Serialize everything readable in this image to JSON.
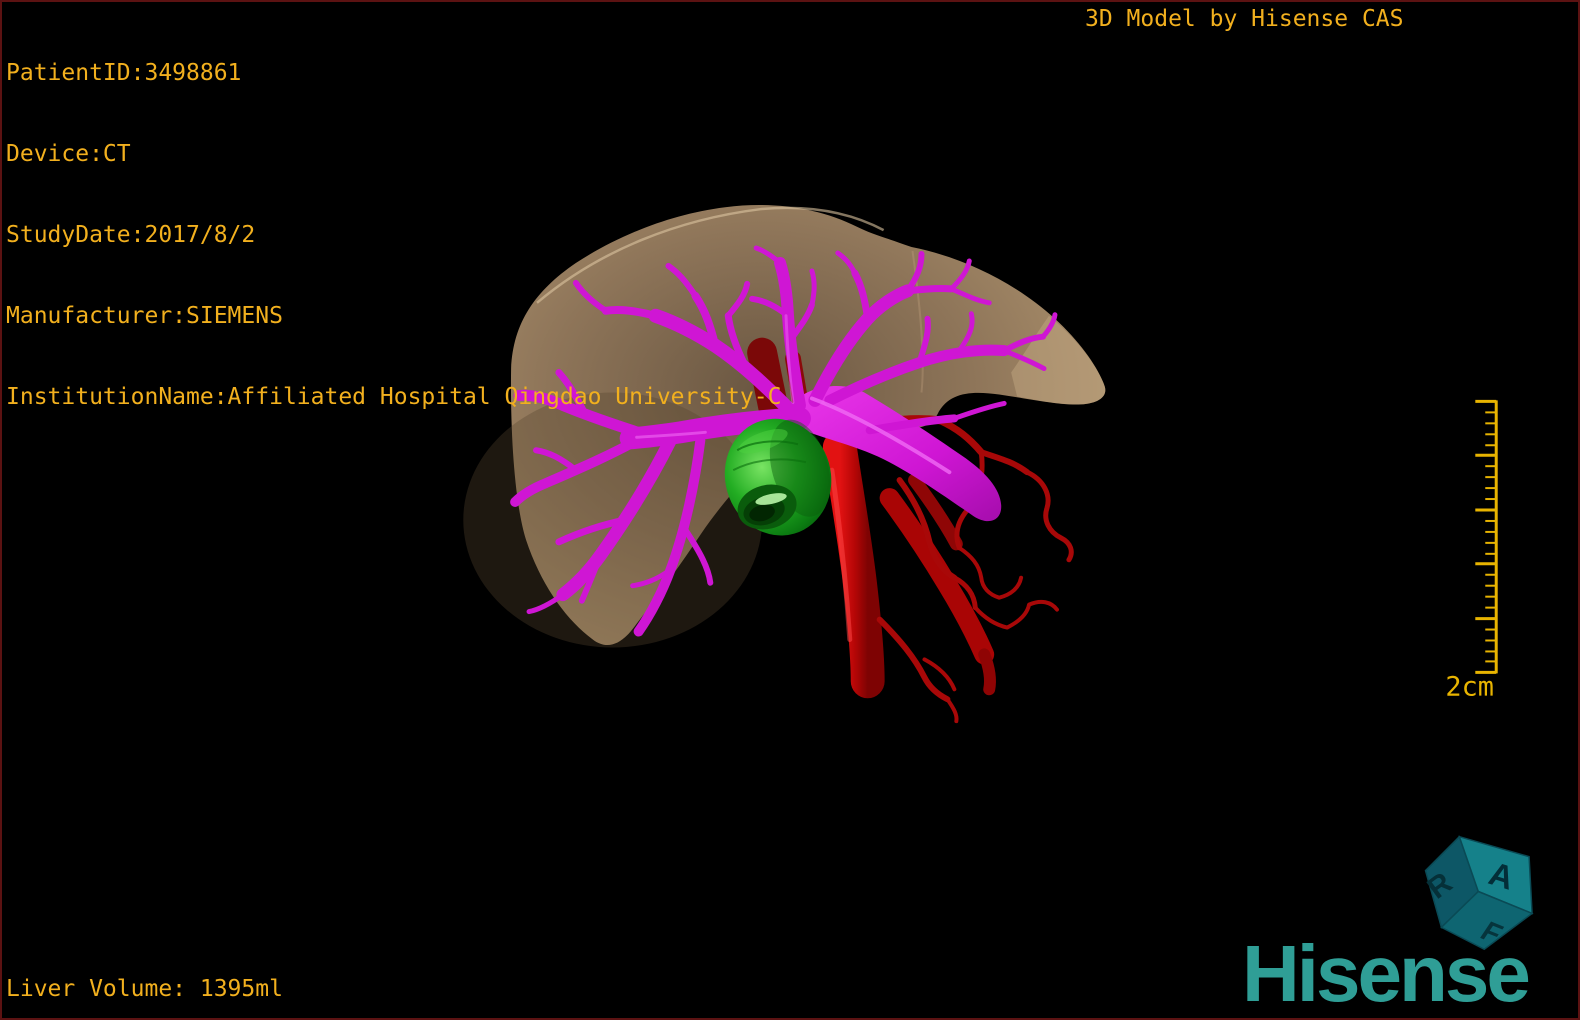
{
  "overlay": {
    "patient_info": [
      "PatientID:3498861",
      "Device:CT",
      "StudyDate:2017/8/2",
      "Manufacturer:SIEMENS",
      "InstitutionName:Affiliated Hospital Qingdao University-C"
    ],
    "watermark": "3D Model by Hisense CAS",
    "liver_volume": "Liver Volume: 1395ml",
    "scale_label": "2cm",
    "logo_text": "Hisense",
    "orientation_cube": {
      "top_face": "A",
      "left_face": "R",
      "front_face": "F"
    },
    "colors": {
      "background": "#000000",
      "frame_border": "#5c1212",
      "annotation_text": "#f2b01e",
      "scale_ruler": "#e8b400",
      "logo_teal": "#2f9e96",
      "liver": "#a98c6c",
      "portal_vein": "#cf16d4",
      "artery": "#c00808",
      "gallbladder": "#1f9e1f"
    }
  }
}
